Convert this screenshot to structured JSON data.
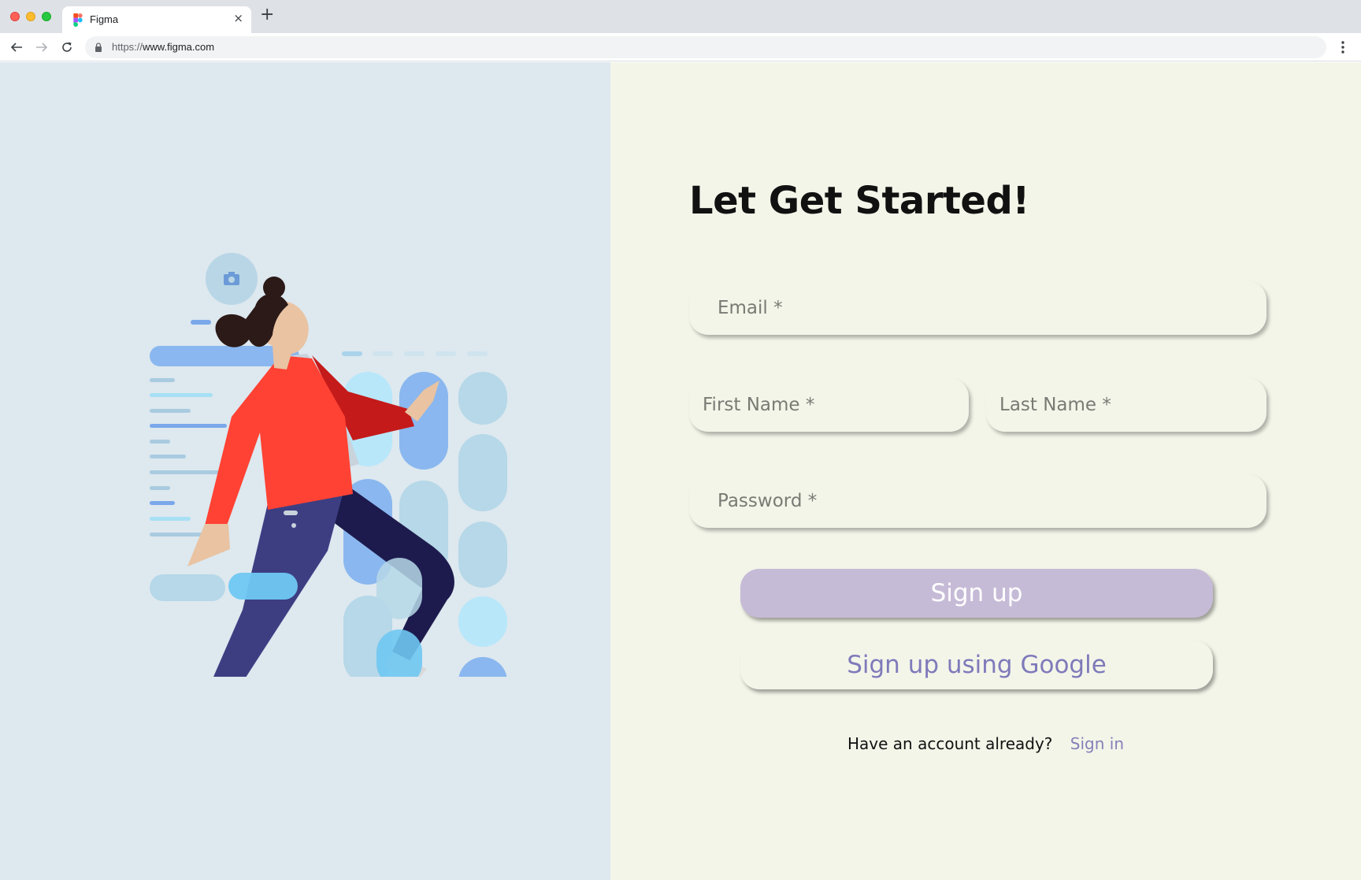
{
  "browser": {
    "tab_title": "Figma",
    "tab_close_glyph": "×",
    "new_tab_glyph": "+",
    "url_scheme": "https://",
    "url_host": "www.figma.com",
    "icons": [
      "back-arrow-icon",
      "forward-arrow-icon",
      "reload-icon",
      "lock-icon",
      "kebab-menu-icon",
      "figma-favicon"
    ]
  },
  "form": {
    "heading": "Let Get Started!",
    "email_placeholder": "Email *",
    "first_name_placeholder": "First Name *",
    "last_name_placeholder": "Last Name *",
    "password_placeholder": "Password *",
    "signup_label": "Sign up",
    "google_label": "Sign up using Google",
    "account_prompt": "Have an account already?",
    "signin_label": "Sign in"
  },
  "colors": {
    "left_background": "#dde8ef",
    "right_background": "#f3f5e9",
    "signup_button": "#c6bbd7",
    "accent_text": "#7f7aba",
    "figure_jacket": "#ff4233",
    "figure_pants": "#3d3e82"
  }
}
